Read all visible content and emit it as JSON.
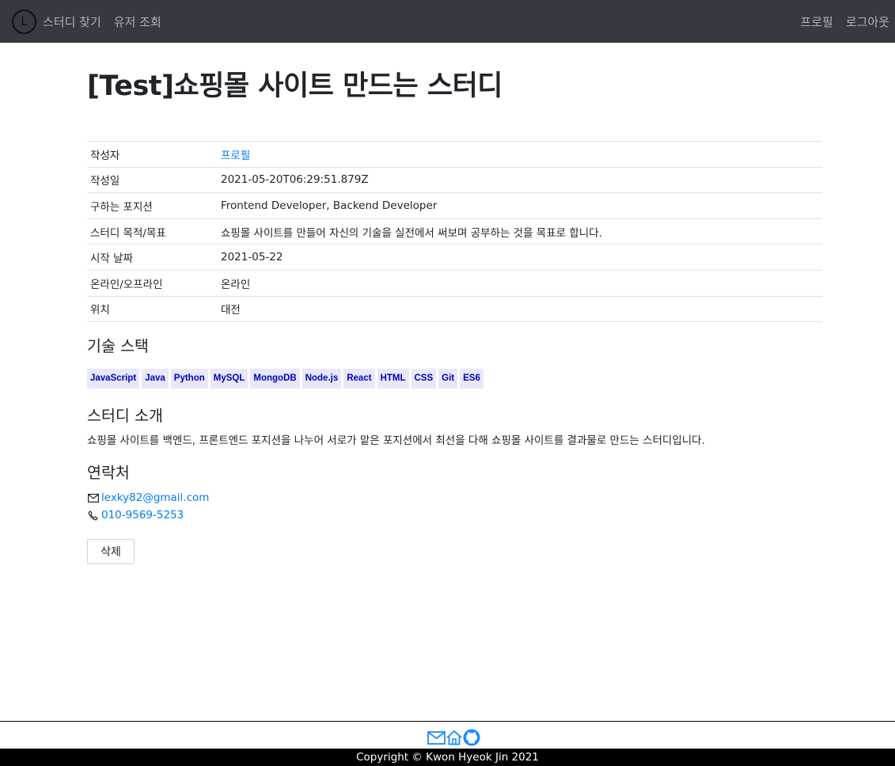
{
  "nav": {
    "logo_letter": "L",
    "find_study": "스터디 찾기",
    "user_lookup": "유저 조회",
    "profile": "프로필",
    "logout": "로그아웃"
  },
  "study": {
    "title": "[Test]쇼핑몰 사이트 만드는 스터디",
    "details": [
      {
        "label": "작성자",
        "value": "프로필",
        "is_link": true
      },
      {
        "label": "작성일",
        "value": "2021-05-20T06:29:51.879Z"
      },
      {
        "label": "구하는 포지션",
        "value": "Frontend Developer, Backend Developer"
      },
      {
        "label": "스터디 목적/목표",
        "value": "쇼핑몰 사이트를 만들어 자신의 기술을 실전에서 써보며 공부하는 것을 목표로 합니다."
      },
      {
        "label": "시작 날짜",
        "value": "2021-05-22"
      },
      {
        "label": "온라인/오프라인",
        "value": "온라인"
      },
      {
        "label": "위치",
        "value": "대전"
      }
    ],
    "tech_heading": "기술 스택",
    "tech_stack": [
      "JavaScript",
      "Java",
      "Python",
      "MySQL",
      "MongoDB",
      "Node.js",
      "React",
      "HTML",
      "CSS",
      "Git",
      "ES6"
    ],
    "intro_heading": "스터디 소개",
    "intro_text": "쇼핑몰 사이트를 백엔드, 프론트엔드 포지션을 나누어 서로가 맡은 포지션에서 최선을 다해 쇼핑몰 사이트를 결과물로 만드는 스터디입니다.",
    "contact_heading": "연락처",
    "email": "lexky82@gmail.com",
    "phone": "010-9569-5253",
    "delete_label": "삭제"
  },
  "footer": {
    "copyright": "Copyright © Kwon Hyeok Jin 2021"
  },
  "colors": {
    "navbar_bg": "#343a40",
    "link": "#007bff",
    "badge_bg": "#e8e8fa",
    "badge_text": "#0000c0"
  }
}
